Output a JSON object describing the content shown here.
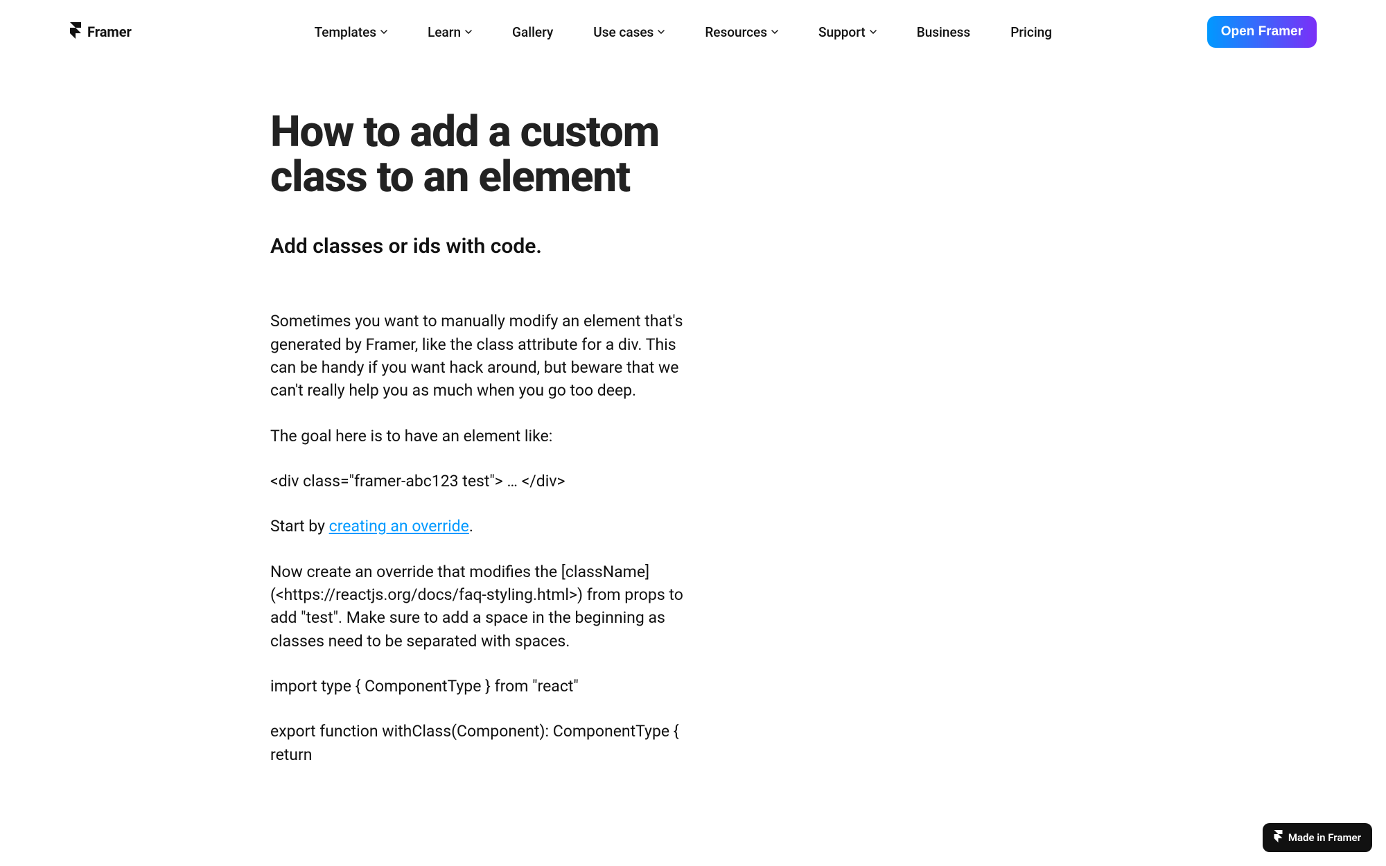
{
  "brand": "Framer",
  "nav": {
    "items": [
      {
        "label": "Templates",
        "dropdown": true
      },
      {
        "label": "Learn",
        "dropdown": true
      },
      {
        "label": "Gallery",
        "dropdown": false
      },
      {
        "label": "Use cases",
        "dropdown": true
      },
      {
        "label": "Resources",
        "dropdown": true
      },
      {
        "label": "Support",
        "dropdown": true
      },
      {
        "label": "Business",
        "dropdown": false
      },
      {
        "label": "Pricing",
        "dropdown": false
      }
    ],
    "cta": "Open Framer"
  },
  "article": {
    "title": "How to add a custom class to an element",
    "subtitle": "Add classes or ids with code.",
    "p1": "Sometimes you want to manually modify an element that's generated by Framer, like the class attribute for a div. This can be handy if you want hack around, but beware that we can't really help you as much when you go too deep.",
    "p2": "The goal here is to have an element like:",
    "p3": "<div class=\"framer-abc123 test\"> … </div>",
    "p4_pre": "Start by ",
    "p4_link": "creating an override",
    "p4_post": ".",
    "p5": "Now create an override that modifies the [className](<https://reactjs.org/docs/faq-styling.html>) from props to add \"test\". Make sure to add a space in the beginning as classes need to be separated with spaces.",
    "p6": "import type { ComponentType } from \"react\"",
    "p7": "export function withClass(Component): ComponentType { return"
  },
  "badge": "Made in Framer"
}
